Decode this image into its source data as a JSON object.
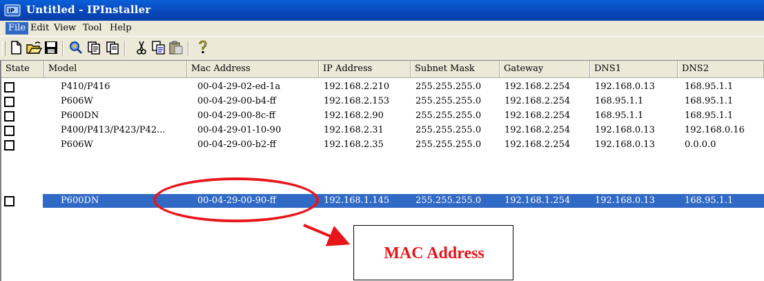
{
  "window": {
    "title": "Untitled - IPInstaller"
  },
  "menu": {
    "items": [
      {
        "label": "File"
      },
      {
        "label": "Edit"
      },
      {
        "label": "View"
      },
      {
        "label": "Tool"
      },
      {
        "label": "Help"
      }
    ]
  },
  "toolbar": {
    "icons": [
      "new-file-icon",
      "open-folder-icon",
      "save-icon",
      "search-device-icon",
      "page-icon",
      "page-icon-2",
      "cut-icon",
      "copy-icon",
      "paste-icon",
      "help-icon"
    ]
  },
  "table": {
    "columns": [
      "State",
      "Model",
      "Mac Address",
      "IP Address",
      "Subnet Mask",
      "Gateway",
      "DNS1",
      "DNS2"
    ],
    "rows": [
      {
        "model": "P410/P416",
        "mac": "00-04-29-02-ed-1a",
        "ip": "192.168.2.210",
        "mask": "255.255.255.0",
        "gateway": "192.168.2.254",
        "dns1": "192.168.0.13",
        "dns2": "168.95.1.1",
        "selected": false
      },
      {
        "model": "P606W",
        "mac": "00-04-29-00-b4-ff",
        "ip": "192.168.2.153",
        "mask": "255.255.255.0",
        "gateway": "192.168.2.254",
        "dns1": "168.95.1.1",
        "dns2": "168.95.1.1",
        "selected": false
      },
      {
        "model": "P600DN",
        "mac": "00-04-29-00-8c-ff",
        "ip": "192.168.2.90",
        "mask": "255.255.255.0",
        "gateway": "192.168.2.254",
        "dns1": "168.95.1.1",
        "dns2": "168.95.1.1",
        "selected": false
      },
      {
        "model": "P400/P413/P423/P42...",
        "mac": "00-04-29-01-10-90",
        "ip": "192.168.2.31",
        "mask": "255.255.255.0",
        "gateway": "192.168.2.254",
        "dns1": "192.168.0.13",
        "dns2": "192.168.0.16",
        "selected": false
      },
      {
        "model": "P606W",
        "mac": "00-04-29-00-b2-ff",
        "ip": "192.168.2.35",
        "mask": "255.255.255.0",
        "gateway": "192.168.2.254",
        "dns1": "192.168.0.13",
        "dns2": "0.0.0.0",
        "selected": false
      },
      {
        "model": "P600DN",
        "mac": "00-04-29-00-90-ff",
        "ip": "192.168.1.145",
        "mask": "255.255.255.0",
        "gateway": "192.168.1.254",
        "dns1": "192.168.0.13",
        "dns2": "168.95.1.1",
        "selected": true
      }
    ]
  },
  "annotation": {
    "label": "MAC Address",
    "color": "#e8151b"
  },
  "colors": {
    "title_bar": "#0846b8",
    "selection": "#316ac5",
    "chrome": "#ece9d8"
  }
}
